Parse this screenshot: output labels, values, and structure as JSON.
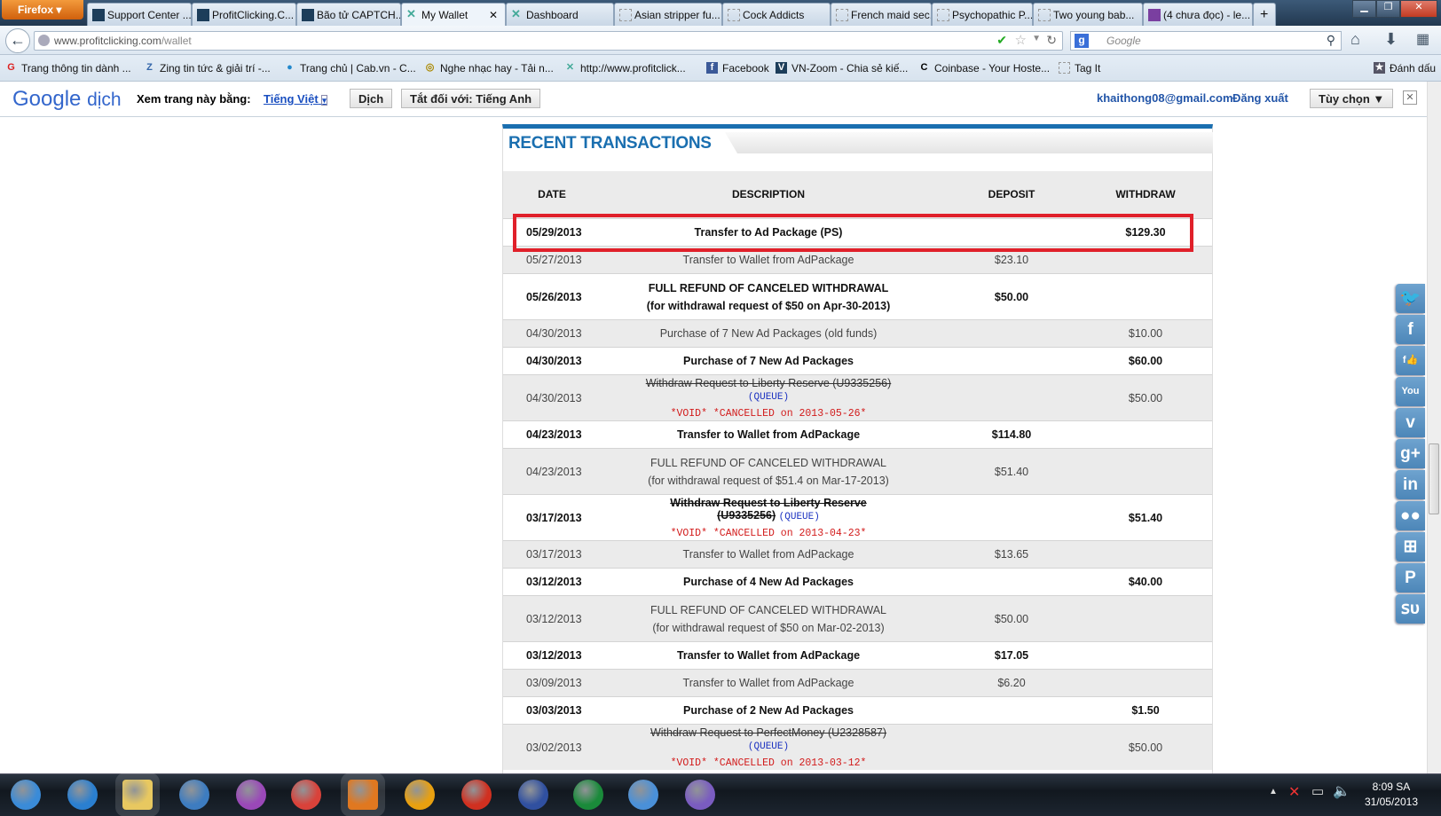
{
  "browser": {
    "menu": "Firefox",
    "tabs": [
      {
        "label": "Support Center ...",
        "icon": "v"
      },
      {
        "label": "ProfitClicking.C...",
        "icon": "v"
      },
      {
        "label": "Bão tử CAPTCH...",
        "icon": "v"
      },
      {
        "label": "My Wallet",
        "icon": "x",
        "active": true
      },
      {
        "label": "Dashboard",
        "icon": "x"
      },
      {
        "label": "Asian stripper fu...",
        "icon": ""
      },
      {
        "label": "Cock Addicts",
        "icon": ""
      },
      {
        "label": "French maid sec...",
        "icon": ""
      },
      {
        "label": "Psychopathic P...",
        "icon": ""
      },
      {
        "label": "Two young bab...",
        "icon": ""
      },
      {
        "label": "(4 chưa đọc) - le...",
        "icon": "m"
      }
    ],
    "new_tab": "+",
    "url_host": "www.profitclicking.com",
    "url_path": "/wallet",
    "search_placeholder": "Google",
    "bookmarks": [
      "Trang thông tin dành ...",
      "Zing tin tức & giải trí -...",
      "Trang chủ | Cab.vn - C...",
      "Nghe nhạc hay - Tải n...",
      "http://www.profitclick...",
      "Facebook",
      "VN-Zoom - Chia sẻ kiế...",
      "Coinbase - Your Hoste...",
      "Tag It"
    ],
    "bookmark_menu": "Đánh dấu"
  },
  "translate": {
    "logo": "Google",
    "logo_suffix": "dịch",
    "view_label": "Xem trang này bằng:",
    "language": "Tiếng Việt",
    "translate_btn": "Dịch",
    "off_btn": "Tắt đối với: Tiếng Anh",
    "account": "khaithong08@gmail.com",
    "logout": "Đăng xuất",
    "options": "Tùy chọn ▼",
    "close": "✕"
  },
  "panel": {
    "title": "RECENT TRANSACTIONS",
    "headers": [
      "DATE",
      "DESCRIPTION",
      "DEPOSIT",
      "WITHDRAW"
    ],
    "rows": [
      {
        "date": "05/29/2013",
        "desc": "Transfer to Ad Package (PS)",
        "deposit": "",
        "withdraw": "$129.30"
      },
      {
        "date": "05/27/2013",
        "desc": "Transfer to Wallet from AdPackage",
        "deposit": "$23.10",
        "withdraw": ""
      },
      {
        "date": "05/26/2013",
        "desc": "FULL REFUND OF CANCELED WITHDRAWAL",
        "desc2": "(for withdrawal request of $50 on Apr-30-2013)",
        "deposit": "$50.00",
        "withdraw": ""
      },
      {
        "date": "04/30/2013",
        "desc": "Purchase of 7 New Ad Packages (old funds)",
        "deposit": "",
        "withdraw": "$10.00"
      },
      {
        "date": "04/30/2013",
        "desc": "Purchase of 7 New Ad Packages",
        "deposit": "",
        "withdraw": "$60.00"
      },
      {
        "date": "04/30/2013",
        "strike": "Withdraw Request to Liberty Reserve (U9335256)",
        "queue": "(QUEUE)",
        "void": "*VOID* *CANCELLED on 2013-05-26*",
        "deposit": "",
        "withdraw": "$50.00"
      },
      {
        "date": "04/23/2013",
        "desc": "Transfer to Wallet from AdPackage",
        "deposit": "$114.80",
        "withdraw": ""
      },
      {
        "date": "04/23/2013",
        "desc": "FULL REFUND OF CANCELED WITHDRAWAL",
        "desc2": "(for withdrawal request of $51.4 on Mar-17-2013)",
        "deposit": "$51.40",
        "withdraw": ""
      },
      {
        "date": "03/17/2013",
        "strike": "Withdraw Request to Liberty Reserve (U9335256)",
        "queue": "(QUEUE)",
        "void": "*VOID* *CANCELLED on 2013-04-23*",
        "deposit": "",
        "withdraw": "$51.40"
      },
      {
        "date": "03/17/2013",
        "desc": "Transfer to Wallet from AdPackage",
        "deposit": "$13.65",
        "withdraw": ""
      },
      {
        "date": "03/12/2013",
        "desc": "Purchase of 4 New Ad Packages",
        "deposit": "",
        "withdraw": "$40.00"
      },
      {
        "date": "03/12/2013",
        "desc": "FULL REFUND OF CANCELED WITHDRAWAL",
        "desc2": "(for withdrawal request of $50 on Mar-02-2013)",
        "deposit": "$50.00",
        "withdraw": ""
      },
      {
        "date": "03/12/2013",
        "desc": "Transfer to Wallet from AdPackage",
        "deposit": "$17.05",
        "withdraw": ""
      },
      {
        "date": "03/09/2013",
        "desc": "Transfer to Wallet from AdPackage",
        "deposit": "$6.20",
        "withdraw": ""
      },
      {
        "date": "03/03/2013",
        "desc": "Purchase of 2 New Ad Packages",
        "deposit": "",
        "withdraw": "$1.50"
      },
      {
        "date": "03/02/2013",
        "strike": "Withdraw Request to PerfectMoney (U2328587)",
        "queue": "(QUEUE)",
        "void": "*VOID* *CANCELLED on 2013-03-12*",
        "deposit": "",
        "withdraw": "$50.00"
      }
    ]
  },
  "social": [
    {
      "name": "twitter",
      "glyph": "🐦"
    },
    {
      "name": "facebook",
      "glyph": "f"
    },
    {
      "name": "facebook-like",
      "glyph": "f👍"
    },
    {
      "name": "youtube",
      "glyph": "You"
    },
    {
      "name": "vimeo",
      "glyph": "v"
    },
    {
      "name": "google-plus",
      "glyph": "g+"
    },
    {
      "name": "linkedin",
      "glyph": "in"
    },
    {
      "name": "flickr",
      "glyph": "●●"
    },
    {
      "name": "windows",
      "glyph": "⊞"
    },
    {
      "name": "pinterest",
      "glyph": "P"
    },
    {
      "name": "stumbleupon",
      "glyph": "ꜱᴜ"
    }
  ],
  "taskbar": {
    "time": "8:09 SA",
    "date": "31/05/2013",
    "apps": [
      {
        "name": "start",
        "color": "#3a8bd8"
      },
      {
        "name": "internet-explorer",
        "color": "#2a7fd0"
      },
      {
        "name": "file-explorer",
        "color": "#e8c860"
      },
      {
        "name": "media-player",
        "color": "#3d7cc0"
      },
      {
        "name": "yahoo-messenger",
        "color": "#9a48b8"
      },
      {
        "name": "chrome",
        "color": "#d9423a"
      },
      {
        "name": "firefox",
        "color": "#e07820"
      },
      {
        "name": "aimp",
        "color": "#e8a010"
      },
      {
        "name": "advanced-app",
        "color": "#d03020"
      },
      {
        "name": "reader",
        "color": "#3050a0"
      },
      {
        "name": "utorrent",
        "color": "#1a8a3a"
      },
      {
        "name": "security-shield",
        "color": "#4a90d8"
      },
      {
        "name": "visual-studio",
        "color": "#7a5cc0"
      }
    ]
  }
}
